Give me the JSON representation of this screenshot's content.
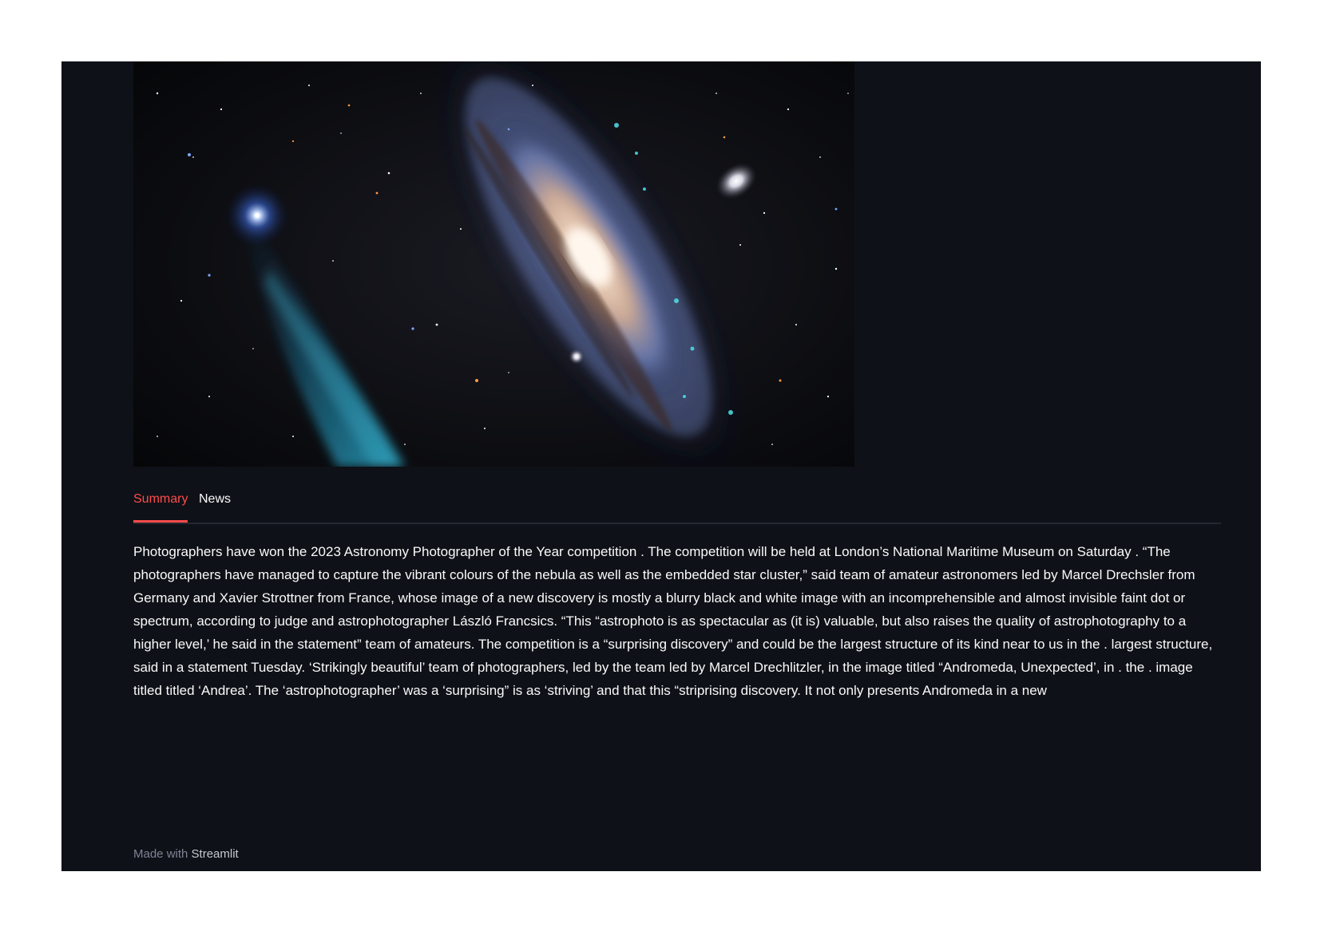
{
  "image": {
    "icon": "galaxy-photo"
  },
  "tabs": [
    {
      "label": "Summary",
      "active": true
    },
    {
      "label": "News",
      "active": false
    }
  ],
  "summary": {
    "text": "Photographers have won the 2023 Astronomy Photographer of the Year competition . The competition will be held at London’s National Maritime Museum on Saturday . “The photographers have managed to capture the vibrant colours of the nebula as well as the embedded star cluster,” said team of amateur astronomers led by Marcel Drechsler from Germany and Xavier Strottner from France, whose image of a new discovery is mostly a blurry black and white image with an incomprehensible and almost invisible faint dot or spectrum, according to judge and astrophotographer László Francsics. “This “astrophoto is as spectacular as (it is) valuable, but also raises the quality of astrophotography to a higher level,’ he said in the statement” team of amateurs. The competition is a “surprising discovery” and could be the largest structure of its kind near to us in the . largest structure, said in a statement Tuesday. ‘Strikingly beautiful’ team of photographers, led by the team led by Marcel Drechlitzler, in the image titled “Andromeda, Unexpected’, in . the . image titled titled ‘Andrea’. The ‘astrophotographer’ was a ‘surprising” is as ‘striving’ and that this “striprising discovery. It not only presents Andromeda in a new"
  },
  "footer": {
    "prefix": "Made with",
    "brand": "Streamlit"
  },
  "colors": {
    "background": "#0e1117",
    "accent": "#ff4b4b",
    "text": "#fafafa",
    "muted": "#808495"
  }
}
